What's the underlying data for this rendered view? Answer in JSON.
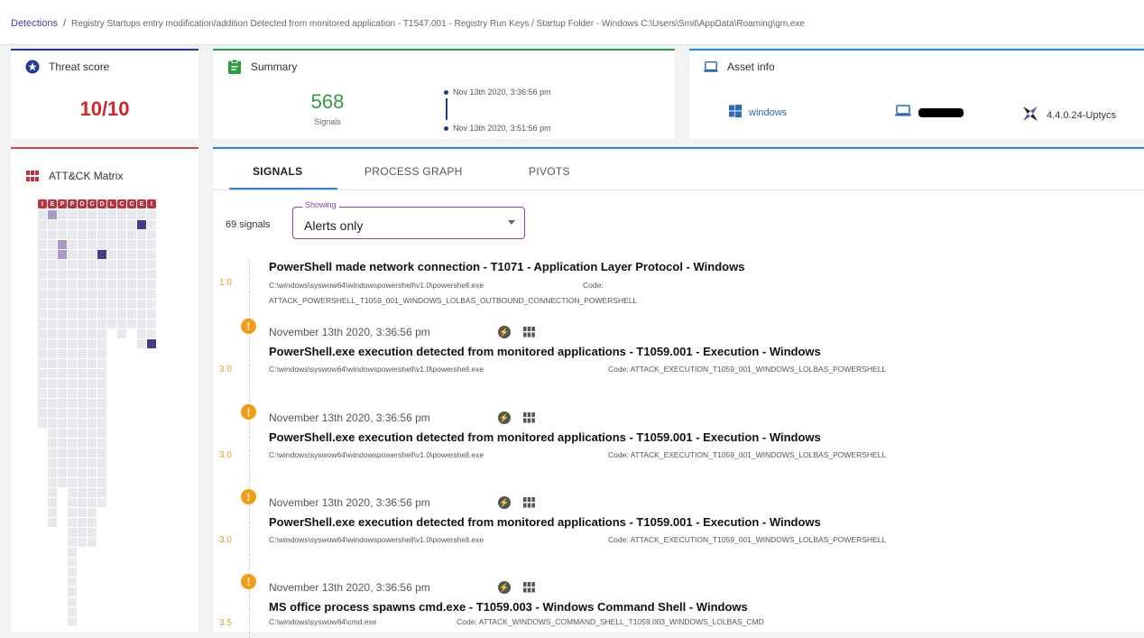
{
  "breadcrumb": {
    "link": "Detections",
    "separator": "/",
    "current": "Registry Startups entry modification/addition Detected from monitored application - T1547.001 - Registry Run Keys / Startup Folder - Windows C:\\Users\\Smit\\AppData\\Roaming\\gm.exe"
  },
  "threat": {
    "title": "Threat score",
    "value": "10/10"
  },
  "summary": {
    "title": "Summary",
    "signal_count": "568",
    "signal_label": "Signals",
    "start_time": "Nov 13th 2020, 3:36:56 pm",
    "end_time": "Nov 13th 2020, 3:51:56 pm"
  },
  "asset": {
    "title": "Asset info",
    "os": "windows",
    "version": "4.4.0.24-Uptycs"
  },
  "attck": {
    "title": "ATT&CK Matrix",
    "tactic_tags": [
      "I",
      "E",
      "P",
      "P",
      "D",
      "C",
      "D",
      "L",
      "C",
      "C",
      "E",
      "I"
    ]
  },
  "tabs": [
    "SIGNALS",
    "PROCESS GRAPH",
    "PIVOTS"
  ],
  "filter": {
    "count_label": "69 signals",
    "legend": "Showing",
    "value": "Alerts only"
  },
  "signals": [
    {
      "score": "1.0",
      "time": "",
      "title": "PowerShell made network connection - T1071 - Application Layer Protocol - Windows",
      "path": "C:\\windows\\syswow64\\windowspowershell\\v1.0\\powershell.exe",
      "code": "Code:",
      "code_line2": "ATTACK_POWERSHELL_T1059_001_WINDOWS_LOLBAS_OUTBOUND_CONNECTION_POWERSHELL"
    },
    {
      "score": "3.0",
      "time": "November 13th 2020, 3:36:56 pm",
      "title": "PowerShell.exe execution detected from monitored applications - T1059.001 - Execution - Windows",
      "path": "C:\\windows\\syswow64\\windowspowershell\\v1.0\\powershell.exe",
      "code": "Code: ATTACK_EXECUTION_T1059_001_WINDOWS_LOLBAS_POWERSHELL"
    },
    {
      "score": "3.0",
      "time": "November 13th 2020, 3:36:56 pm",
      "title": "PowerShell.exe execution detected from monitored applications - T1059.001 - Execution - Windows",
      "path": "C:\\windows\\syswow64\\windowspowershell\\v1.0\\powershell.exe",
      "code": "Code: ATTACK_EXECUTION_T1059_001_WINDOWS_LOLBAS_POWERSHELL"
    },
    {
      "score": "3.0",
      "time": "November 13th 2020, 3:36:56 pm",
      "title": "PowerShell.exe execution detected from monitored applications - T1059.001 - Execution - Windows",
      "path": "C:\\windows\\syswow64\\windowspowershell\\v1.0\\powershell.exe",
      "code": "Code: ATTACK_EXECUTION_T1059_001_WINDOWS_LOLBAS_POWERSHELL"
    },
    {
      "score": "3.5",
      "time": "November 13th 2020, 3:36:56 pm",
      "title": "MS office process spawns cmd.exe - T1059.003 - Windows Command Shell - Windows",
      "path": "C:\\windows\\syswow64\\cmd.exe",
      "code": "Code: ATTACK_WINDOWS_COMMAND_SHELL_T1059.003_WINDOWS_LOLBAS_CMD"
    }
  ],
  "colors": {
    "accent_purple": "#8b3fb2",
    "threat_red": "#d0262b",
    "signals_green": "#2e9c42",
    "link_blue": "#2d6ab3",
    "warning_orange": "#f39c12"
  }
}
